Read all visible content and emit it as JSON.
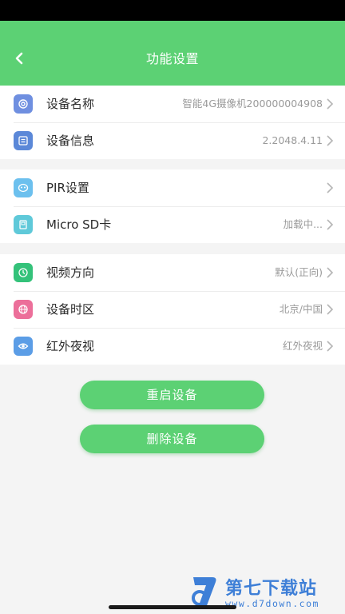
{
  "header": {
    "title": "功能设置",
    "back_icon": "chevron-left-icon"
  },
  "group1": [
    {
      "id": "device-name",
      "label": "设备名称",
      "value": "智能4G摄像机200000004908",
      "icon": "camera-icon",
      "icon_color": "#6f8fe0"
    },
    {
      "id": "device-info",
      "label": "设备信息",
      "value": "2.2048.4.11",
      "icon": "info-doc-icon",
      "icon_color": "#5b88d8"
    }
  ],
  "group2": [
    {
      "id": "pir",
      "label": "PIR设置",
      "value": "",
      "icon": "pir-sensor-icon",
      "icon_color": "#6cc0ee"
    },
    {
      "id": "sd",
      "label": "Micro SD卡",
      "value": "加载中...",
      "icon": "sd-card-icon",
      "icon_color": "#5fc9d9"
    }
  ],
  "group3": [
    {
      "id": "video-dir",
      "label": "视频方向",
      "value": "默认(正向)",
      "icon": "rotate-icon",
      "icon_color": "#34c27a"
    },
    {
      "id": "timezone",
      "label": "设备时区",
      "value": "北京/中国",
      "icon": "globe-icon",
      "icon_color": "#ec6f9a"
    },
    {
      "id": "night-vision",
      "label": "红外夜视",
      "value": "红外夜视",
      "icon": "eye-icon",
      "icon_color": "#5b9de6"
    }
  ],
  "buttons": {
    "restart": "重启设备",
    "delete": "删除设备"
  },
  "watermark": {
    "name": "第七下载站",
    "url": "www.d7down.com"
  },
  "colors": {
    "accent": "#5cd174"
  }
}
